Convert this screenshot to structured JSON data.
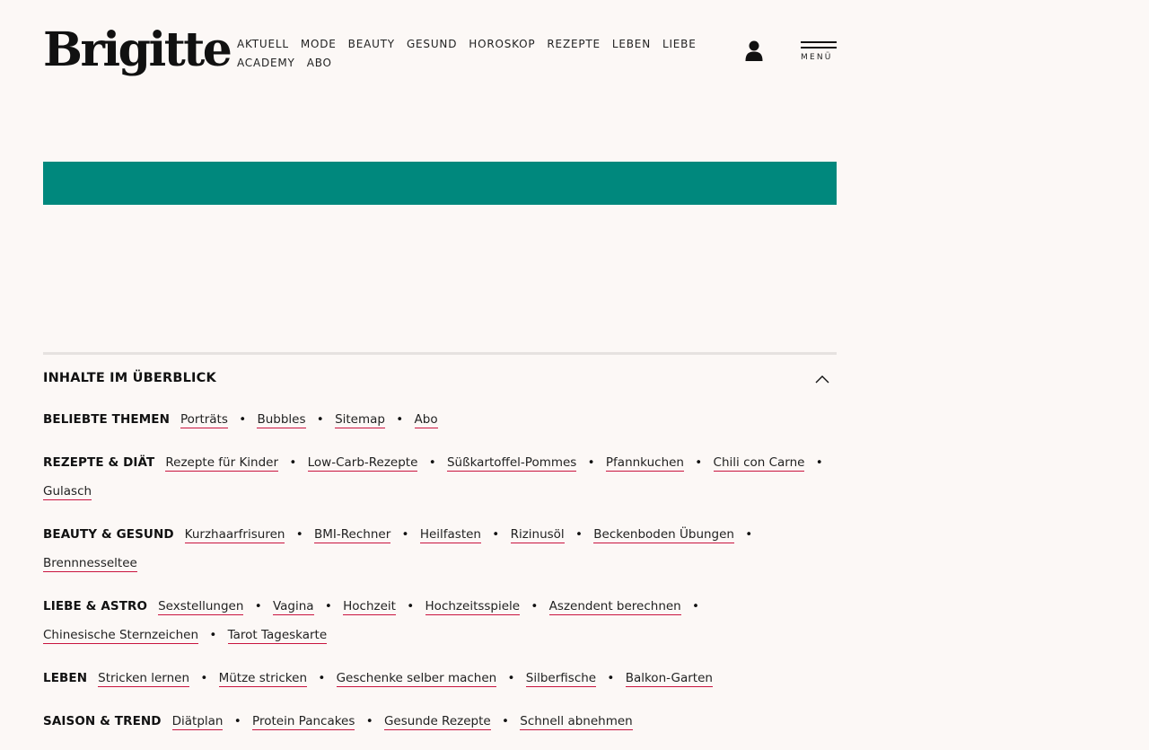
{
  "header": {
    "logo": "Brigitte",
    "nav": [
      "AKTUELL",
      "MODE",
      "BEAUTY",
      "GESUND",
      "HOROSKOP",
      "REZEPTE",
      "LEBEN",
      "LIEBE",
      "ACADEMY",
      "ABO"
    ],
    "menu_label": "MENÜ"
  },
  "banner_color": "#00887d",
  "overview": {
    "title": "INHALTE IM ÜBERBLICK",
    "rows": [
      {
        "title": "BELIEBTE THEMEN",
        "links": [
          "Porträts",
          "Bubbles",
          "Sitemap",
          "Abo"
        ]
      },
      {
        "title": "REZEPTE & DIÄT",
        "links": [
          "Rezepte für Kinder",
          "Low-Carb-Rezepte",
          "Süßkartoffel-Pommes",
          "Pfannkuchen",
          "Chili con Carne",
          "Gulasch"
        ]
      },
      {
        "title": "BEAUTY & GESUND",
        "links": [
          "Kurzhaarfrisuren",
          "BMI-Rechner",
          "Heilfasten",
          "Rizinusöl",
          "Beckenboden Übungen",
          "Brennnesseltee"
        ]
      },
      {
        "title": "LIEBE & ASTRO",
        "links": [
          "Sexstellungen",
          "Vagina",
          "Hochzeit",
          "Hochzeitsspiele",
          "Aszendent berechnen",
          "Chinesische Sternzeichen",
          "Tarot Tageskarte"
        ]
      },
      {
        "title": "LEBEN",
        "links": [
          "Stricken lernen",
          "Mütze stricken",
          "Geschenke selber machen",
          "Silberfische",
          "Balkon-Garten"
        ]
      },
      {
        "title": "SAISON & TREND",
        "links": [
          "Diätplan",
          "Protein Pancakes",
          "Gesunde Rezepte",
          "Schnell abnehmen"
        ]
      }
    ]
  }
}
